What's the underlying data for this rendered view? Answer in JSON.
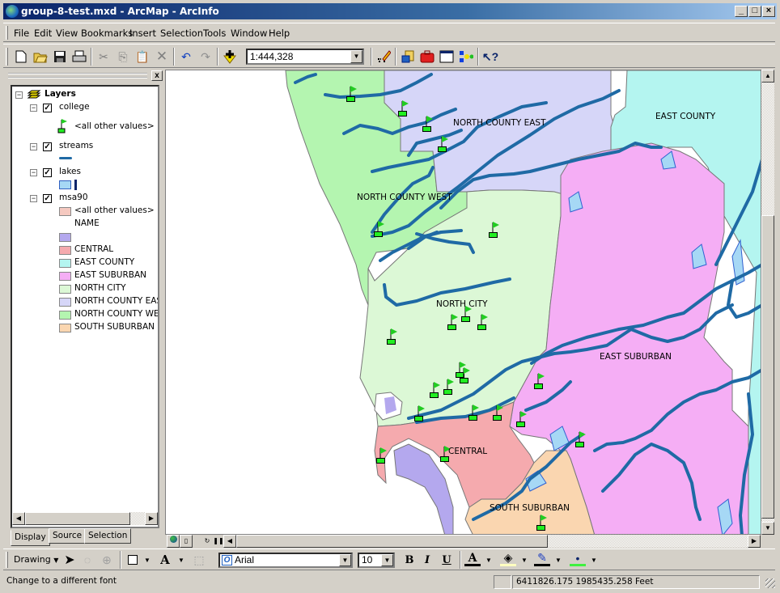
{
  "window": {
    "title": "group-8-test.mxd - ArcMap - ArcInfo",
    "minimize_label": "_",
    "maximize_label": "□",
    "close_label": "×"
  },
  "menu": [
    "File",
    "Edit",
    "View",
    "Bookmarks",
    "Insert",
    "Selection",
    "Tools",
    "Window",
    "Help"
  ],
  "toolbar": {
    "scale_value": "1:444,328",
    "buttons": [
      "new",
      "open",
      "save",
      "print",
      "cut",
      "copy",
      "paste",
      "delete",
      "undo",
      "redo",
      "add-data",
      "editor",
      "arccatalog",
      "arctoolbox",
      "command-line",
      "model-builder",
      "whats-this"
    ]
  },
  "toc": {
    "close_label": "x",
    "root_label": "Layers",
    "layers": [
      {
        "name": "college",
        "checked": true,
        "legend": [
          {
            "label": "<all other values>",
            "symbol": "flag"
          }
        ]
      },
      {
        "name": "streams",
        "checked": true,
        "legend": [
          {
            "label": "",
            "symbol": "line",
            "color": "#1f6aa5"
          }
        ]
      },
      {
        "name": "lakes",
        "checked": true,
        "legend": [
          {
            "label": "",
            "symbol": "polygon",
            "color": "#a6d8f5"
          }
        ]
      },
      {
        "name": "msa90",
        "checked": true,
        "legend": [
          {
            "label": "<all other values>",
            "color": "#f5c9c0"
          },
          {
            "label": "NAME",
            "color": null
          },
          {
            "label": "",
            "color": "#b4a8ee"
          },
          {
            "label": "CENTRAL",
            "color": "#f5aaae"
          },
          {
            "label": "EAST COUNTY",
            "color": "#b4f5f0"
          },
          {
            "label": "EAST SUBURBAN",
            "color": "#f5aef5"
          },
          {
            "label": "NORTH CITY",
            "color": "#dcf8d6"
          },
          {
            "label": "NORTH COUNTY EAST",
            "color": "#d6d6f8"
          },
          {
            "label": "NORTH COUNTY WEST",
            "color": "#b4f5b0"
          },
          {
            "label": "SOUTH SUBURBAN",
            "color": "#fad6b0"
          }
        ]
      }
    ],
    "tabs": [
      "Display",
      "Source",
      "Selection"
    ],
    "active_tab": "Display"
  },
  "map": {
    "region_labels": [
      "NORTH COUNTY EAST",
      "EAST COUNTY",
      "NORTH COUNTY WEST",
      "NORTH CITY",
      "EAST SUBURBAN",
      "CENTRAL",
      "SOUTH SUBURBAN"
    ],
    "colors": {
      "north_county_west": "#b4f5b0",
      "north_county_east": "#d6d6f8",
      "east_county": "#b4f5f0",
      "north_city": "#dcf8d6",
      "east_suburban": "#f5aef5",
      "central": "#f5aaae",
      "south_suburban": "#fad6b0",
      "bay": "#b4a8ee",
      "stream": "#1f6aa5",
      "lake": "#a6d8f5",
      "flag": "#22cc22"
    }
  },
  "drawing_toolbar": {
    "drawing_label": "Drawing",
    "font_value": "Arial",
    "size_value": "10",
    "bold_label": "B",
    "italic_label": "I",
    "underline_label": "U"
  },
  "status": {
    "message": "Change to a different font",
    "coordinates": "6411826.175  1985435.258 Feet"
  }
}
